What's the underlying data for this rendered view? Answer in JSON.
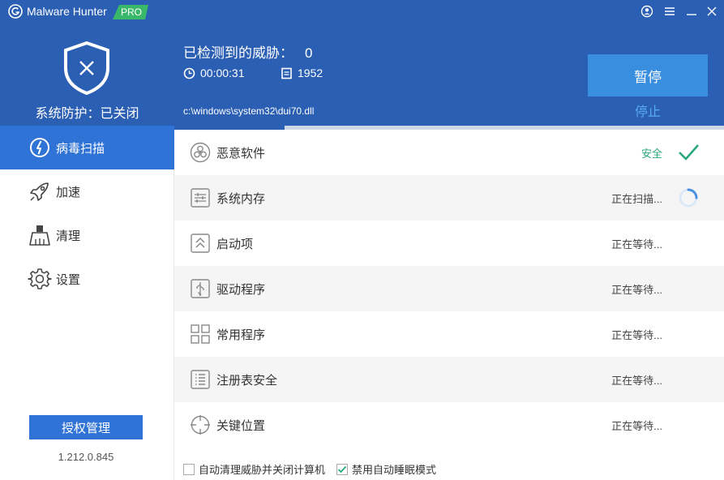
{
  "app": {
    "title": "Malware Hunter",
    "badge": "PRO",
    "colors": {
      "header": "#2b5fb4",
      "accent": "#2f73d6",
      "pause": "#3a8ee0",
      "badge": "#3ab86a",
      "safe": "#2aa87a"
    }
  },
  "window_controls": [
    "user-icon",
    "menu-icon",
    "minimize-icon",
    "close-icon"
  ],
  "header": {
    "protection_status": "系统防护：已关闭",
    "threats_label": "已检测到的威胁：",
    "threats_count": "0",
    "elapsed_time": "00:00:31",
    "files_scanned": "1952",
    "current_path": "c:\\windows\\system32\\dui70.dll",
    "progress_percent": 20,
    "pause_label": "暂停",
    "stop_label": "停止"
  },
  "sidebar": {
    "items": [
      {
        "label": "病毒扫描",
        "icon": "scan-icon",
        "active": true
      },
      {
        "label": "加速",
        "icon": "rocket-icon",
        "active": false
      },
      {
        "label": "清理",
        "icon": "broom-icon",
        "active": false
      },
      {
        "label": "设置",
        "icon": "gear-icon",
        "active": false
      }
    ],
    "license_label": "授权管理",
    "version": "1.212.0.845"
  },
  "scan_items": [
    {
      "label": "恶意软件",
      "status": "安全",
      "state": "safe",
      "icon": "biohazard-icon"
    },
    {
      "label": "系统内存",
      "status": "正在扫描...",
      "state": "scanning",
      "icon": "memory-icon"
    },
    {
      "label": "启动项",
      "status": "正在等待...",
      "state": "waiting",
      "icon": "startup-icon"
    },
    {
      "label": "驱动程序",
      "status": "正在等待...",
      "state": "waiting",
      "icon": "usb-icon"
    },
    {
      "label": "常用程序",
      "status": "正在等待...",
      "state": "waiting",
      "icon": "apps-icon"
    },
    {
      "label": "注册表安全",
      "status": "正在等待...",
      "state": "waiting",
      "icon": "registry-icon"
    },
    {
      "label": "关键位置",
      "status": "正在等待...",
      "state": "waiting",
      "icon": "crosshair-icon"
    }
  ],
  "footer": {
    "options": [
      {
        "label": "自动清理威胁并关闭计算机",
        "checked": false
      },
      {
        "label": "禁用自动睡眠模式",
        "checked": true
      }
    ]
  }
}
